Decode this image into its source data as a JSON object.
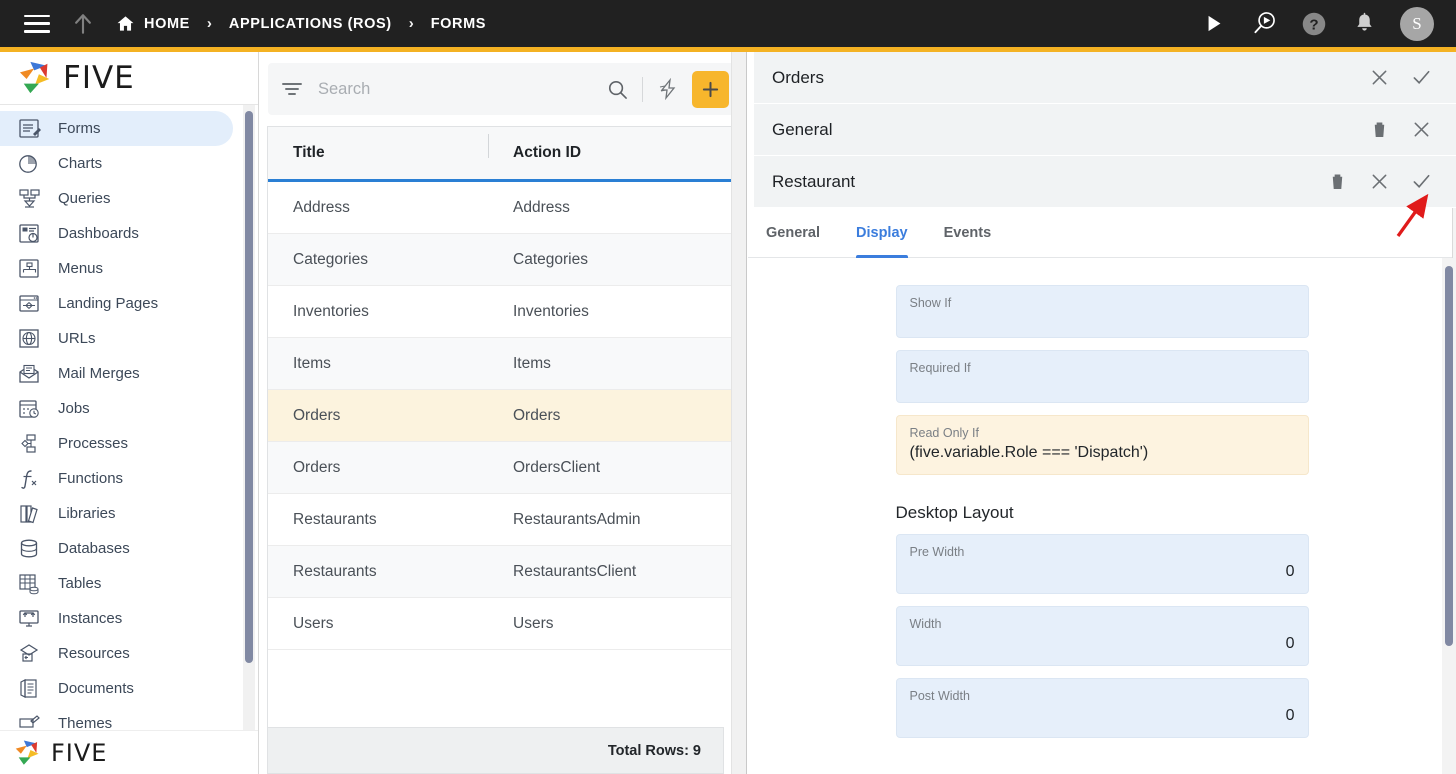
{
  "topbar": {
    "menu_icon": "hamburger-icon",
    "up_icon": "arrow-up-icon",
    "home_icon": "home-icon",
    "breadcrumbs": [
      {
        "label": "HOME",
        "icon": "home-icon"
      },
      {
        "label": "APPLICATIONS (ROS)",
        "icon": ""
      },
      {
        "label": "FORMS",
        "icon": ""
      }
    ],
    "separator": "›",
    "actions": [
      {
        "name": "run-icon",
        "title": "Run"
      },
      {
        "name": "search-run-icon",
        "title": "Search and Run"
      },
      {
        "name": "help-icon",
        "title": "Help"
      },
      {
        "name": "notifications-bell-icon",
        "title": "Notifications"
      }
    ],
    "avatar_initial": "S"
  },
  "sidebar": {
    "logo_text": "FIVE",
    "bottom_logo_text": "FIVE",
    "items": [
      {
        "label": "Forms",
        "icon": "forms-icon",
        "active": true
      },
      {
        "label": "Charts",
        "icon": "charts-icon",
        "active": false
      },
      {
        "label": "Queries",
        "icon": "queries-icon",
        "active": false
      },
      {
        "label": "Dashboards",
        "icon": "dashboards-icon",
        "active": false
      },
      {
        "label": "Menus",
        "icon": "menus-icon",
        "active": false
      },
      {
        "label": "Landing Pages",
        "icon": "landing-pages-icon",
        "active": false
      },
      {
        "label": "URLs",
        "icon": "urls-icon",
        "active": false
      },
      {
        "label": "Mail Merges",
        "icon": "mail-merges-icon",
        "active": false
      },
      {
        "label": "Jobs",
        "icon": "jobs-icon",
        "active": false
      },
      {
        "label": "Processes",
        "icon": "processes-icon",
        "active": false
      },
      {
        "label": "Functions",
        "icon": "functions-icon",
        "active": false
      },
      {
        "label": "Libraries",
        "icon": "libraries-icon",
        "active": false
      },
      {
        "label": "Databases",
        "icon": "databases-icon",
        "active": false
      },
      {
        "label": "Tables",
        "icon": "tables-icon",
        "active": false
      },
      {
        "label": "Instances",
        "icon": "instances-icon",
        "active": false
      },
      {
        "label": "Resources",
        "icon": "resources-icon",
        "active": false
      },
      {
        "label": "Documents",
        "icon": "documents-icon",
        "active": false
      },
      {
        "label": "Themes",
        "icon": "themes-icon",
        "active": false
      }
    ]
  },
  "list_panel": {
    "search": {
      "value": "",
      "placeholder": "Search"
    },
    "filter_icon": "filter-icon",
    "search_icon": "search-icon",
    "bolt_icon": "lightning-bolt-icon",
    "add_label": "+",
    "columns": [
      "Title",
      "Action ID"
    ],
    "rows": [
      {
        "title": "Address",
        "action_id": "Address"
      },
      {
        "title": "Categories",
        "action_id": "Categories"
      },
      {
        "title": "Inventories",
        "action_id": "Inventories"
      },
      {
        "title": "Items",
        "action_id": "Items"
      },
      {
        "title": "Orders",
        "action_id": "Orders"
      },
      {
        "title": "Orders",
        "action_id": "OrdersClient"
      },
      {
        "title": "Restaurants",
        "action_id": "RestaurantsAdmin"
      },
      {
        "title": "Restaurants",
        "action_id": "RestaurantsClient"
      },
      {
        "title": "Users",
        "action_id": "Users"
      }
    ],
    "selected_row_index": 4,
    "footer": "Total Rows: 9"
  },
  "detail_panel": {
    "bars": [
      {
        "title": "Orders",
        "actions": [
          "close-icon",
          "check-icon"
        ]
      },
      {
        "title": "General",
        "actions": [
          "delete-icon",
          "close-icon"
        ]
      },
      {
        "title": "Restaurant",
        "actions": [
          "delete-icon",
          "close-icon",
          "check-icon"
        ]
      }
    ],
    "tabs": [
      {
        "label": "General",
        "active": false
      },
      {
        "label": "Display",
        "active": true
      },
      {
        "label": "Events",
        "active": false
      }
    ],
    "fields": [
      {
        "label": "Show If",
        "value": "",
        "style": "blue"
      },
      {
        "label": "Required If",
        "value": "",
        "style": "blue"
      },
      {
        "label": "Read Only If",
        "value": "(five.variable.Role === 'Dispatch')",
        "style": "amber"
      }
    ],
    "section_title": "Desktop Layout",
    "layout_fields": [
      {
        "label": "Pre Width",
        "value": "0"
      },
      {
        "label": "Width",
        "value": "0"
      },
      {
        "label": "Post Width",
        "value": "0"
      }
    ]
  },
  "annotation": {
    "type": "red-arrow",
    "points_to": "check-icon"
  },
  "colors": {
    "topbar_bg": "#212121",
    "accent_yellow": "#f4b223",
    "add_button": "#f7b62c",
    "selected_row": "#fcf3de",
    "tab_active": "#3b7ddd",
    "field_blue": "#e6effa",
    "field_amber": "#fdf3e0",
    "annotation_red": "#e01b1b"
  }
}
